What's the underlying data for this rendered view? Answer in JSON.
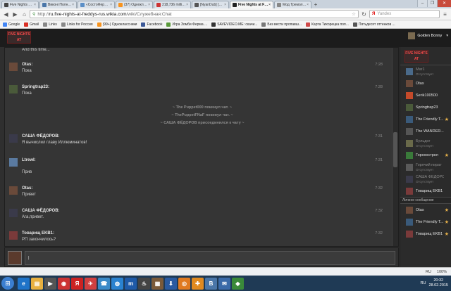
{
  "browser": {
    "tabs": [
      {
        "label": "Five Nights At Fr...",
        "color": "#444444",
        "active": false
      },
      {
        "label": "Виконі Полнол Д...",
        "color": "#4a76a8",
        "active": false
      },
      {
        "label": "«СостоФерма -...",
        "color": "#5b8fc7",
        "active": false
      },
      {
        "label": "(37) Одноклассн...",
        "color": "#f7931e",
        "active": false
      },
      {
        "label": "218,736 million с...",
        "color": "#cc3333",
        "active": false
      },
      {
        "label": "[NyanDub] [4:...",
        "color": "#555555",
        "active": false
      },
      {
        "label": "Five Nights at Fre...",
        "color": "#222222",
        "active": true
      },
      {
        "label": "Мод Тремол ВТ...",
        "color": "#888888",
        "active": false
      }
    ],
    "new_tab": "+",
    "win_min": "–",
    "win_max": "❐",
    "win_close": "✕",
    "nav": {
      "back": "◀",
      "forward": "▶",
      "home": "⌂",
      "refresh": "↻",
      "menu": "≡"
    },
    "url_prefix": "http://",
    "url_domain": "ru.five-nights-at-freddys-rus.wikia.com",
    "url_path": "/wiki/Служебная:Chat",
    "search_engine": "Я",
    "search_placeholder": "Yandex",
    "bookmarks": [
      {
        "label": "Google",
        "color": "#4285f4"
      },
      {
        "label": "Gmail",
        "color": "#d93025"
      },
      {
        "label": "Links",
        "color": "#888888"
      },
      {
        "label": "Links for Россия",
        "color": "#888888"
      },
      {
        "label": "(99+) Одноклассники",
        "color": "#f7931e"
      },
      {
        "label": "Facebook",
        "color": "#3b5998"
      },
      {
        "label": "Игра Зомби Ферма ...",
        "color": "#5a9a3a"
      },
      {
        "label": "SAVEVIDEO.ME: скачи...",
        "color": "#333333"
      },
      {
        "label": "Без вести пропавш...",
        "color": "#777777"
      },
      {
        "label": "Карта Тихорецка поп...",
        "color": "#d04a4a"
      },
      {
        "label": "Пятьдесят оттенков ...",
        "color": "#555555"
      }
    ]
  },
  "wiki": {
    "logo_text": "FIVE NIGHTS AT FREDDY'S",
    "user_name": "Golden Bonny"
  },
  "chat": {
    "top_continuation": "And this time...",
    "messages": [
      {
        "nick": "Otas:",
        "text": "Пока",
        "time": "7:28",
        "color": "#6a4a3a"
      },
      {
        "nick": "Springtrap23:",
        "text": "Пока",
        "time": "7:28",
        "color": "#4a5a3a"
      },
      {
        "nick": "САША ФЁДОРОВ:",
        "text": "Я вычислил главу Иллюминатов!",
        "time": "7:31",
        "color": "#3a3a4a"
      },
      {
        "nick": "Ltrewl:",
        "text": "Прив",
        "time": "7:31",
        "color": "#5a7aa0"
      },
      {
        "nick": "Otas:",
        "text": "Привет",
        "time": "7:32",
        "color": "#6a4a3a"
      },
      {
        "nick": "САША ФЁДОРОВ:",
        "text": "Ага,привет.",
        "time": "7:32",
        "color": "#3a3a4a"
      },
      {
        "nick": "Товарищ EKB1:",
        "text": "РП закончилось?",
        "time": "7:32",
        "color": "#7a3a3a"
      }
    ],
    "alerts": [
      "~ The Puppet000 покинул чат. ~",
      "~ ThePuppetFNaF покинул чат. ~",
      "~ САША ФЁДОРОВ присоединился к чату ~"
    ],
    "input_value": "|"
  },
  "sidebar": {
    "users": [
      {
        "name": "Mar1",
        "status": "Отсутствует",
        "away": true,
        "color": "#4a6a8a"
      },
      {
        "name": "Otas",
        "status": "",
        "away": false,
        "color": "#6a4a3a"
      },
      {
        "name": "Serik100500",
        "status": "",
        "away": false,
        "color": "#c44a2a"
      },
      {
        "name": "Springtrap23",
        "status": "",
        "away": false,
        "color": "#4a5a3a"
      },
      {
        "name": "The Friendly T...",
        "status": "",
        "away": false,
        "star": "★",
        "color": "#3a5a7a"
      },
      {
        "name": "The WANDER...",
        "status": "",
        "away": false,
        "color": "#555555"
      },
      {
        "name": "Бульдог",
        "status": "Отсутствует",
        "away": true,
        "color": "#6a6a4a"
      },
      {
        "name": "Горохострел",
        "status": "",
        "away": false,
        "star": "★",
        "color": "#3a7a3a"
      },
      {
        "name": "Горячий пират",
        "status": "Отсутствует",
        "away": true,
        "color": "#5a5a5a"
      },
      {
        "name": "САША ФЁДОРОВ",
        "status": "Отсутствует",
        "away": true,
        "color": "#3a3a4a"
      },
      {
        "name": "Товарищ EKB1",
        "status": "",
        "away": false,
        "color": "#7a3a3a"
      }
    ],
    "pm_label": "Личное сообщение",
    "pm_users": [
      {
        "name": "Otas",
        "star": "★",
        "color": "#6a4a3a"
      },
      {
        "name": "The Friendly T...",
        "star": "★",
        "color": "#3a5a7a"
      },
      {
        "name": "Товарищ EKB1",
        "star": "★",
        "color": "#7a3a3a"
      }
    ]
  },
  "statusbar": {
    "lang": "RU",
    "zoom": "100%"
  },
  "taskbar": {
    "start": "⊞",
    "apps": [
      {
        "glyph": "e",
        "color": "#1e73c8"
      },
      {
        "glyph": "▤",
        "color": "#e8b040"
      },
      {
        "glyph": "▶",
        "color": "#555555"
      },
      {
        "glyph": "◉",
        "color": "#cc3333"
      },
      {
        "glyph": "Я",
        "color": "#cc2222"
      },
      {
        "glyph": "✈",
        "color": "#d04040"
      },
      {
        "glyph": "☎",
        "color": "#3a8ac8"
      },
      {
        "glyph": "◍",
        "color": "#2a82d0"
      },
      {
        "glyph": "m",
        "color": "#1e5aa8"
      },
      {
        "glyph": "♨",
        "color": "#444444"
      },
      {
        "glyph": "▦",
        "color": "#7a5a3a"
      },
      {
        "glyph": "⬇",
        "color": "#2a5aa0"
      },
      {
        "glyph": "◎",
        "color": "#e07a20"
      },
      {
        "glyph": "✚",
        "color": "#e08a20"
      },
      {
        "glyph": "В",
        "color": "#4a76a8"
      },
      {
        "glyph": "✉",
        "color": "#3a6aa8"
      },
      {
        "glyph": "◆",
        "color": "#3a8a3a"
      }
    ],
    "tray_lang": "RU",
    "time": "20:32",
    "date": "28.02.2015"
  }
}
